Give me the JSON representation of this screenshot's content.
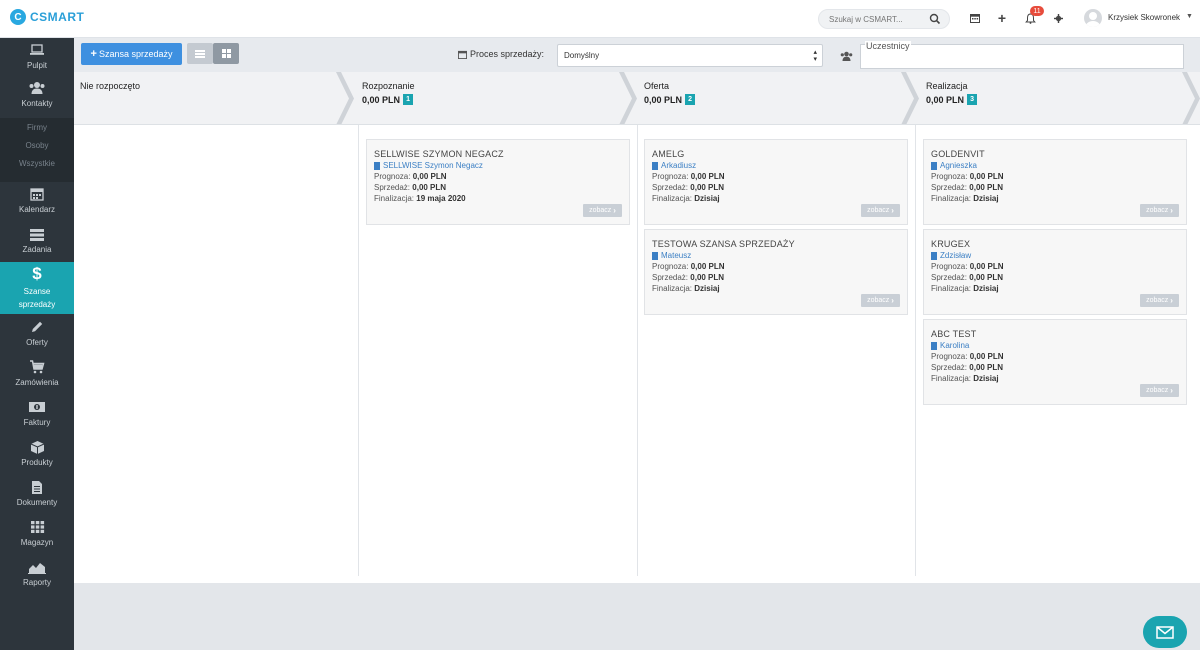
{
  "app": {
    "logo_text": "CSMART"
  },
  "header": {
    "search_placeholder": "Szukaj w CSMART...",
    "notification_count": "11",
    "user_name": "Krzysiek Skowronek"
  },
  "sidebar": {
    "items": [
      {
        "label": "Pulpit",
        "icon": "laptop-icon"
      },
      {
        "label": "Kontakty",
        "icon": "contacts-icon"
      },
      {
        "label": "Kalendarz",
        "icon": "calendar-icon"
      },
      {
        "label": "Zadania",
        "icon": "tasks-icon"
      },
      {
        "label": "Szanse sprzedaży",
        "icon": "dollar-icon"
      },
      {
        "label": "Oferty",
        "icon": "pencil-icon"
      },
      {
        "label": "Zamówienia",
        "icon": "cart-icon"
      },
      {
        "label": "Faktury",
        "icon": "money-icon"
      },
      {
        "label": "Produkty",
        "icon": "box-icon"
      },
      {
        "label": "Dokumenty",
        "icon": "document-icon"
      },
      {
        "label": "Magazyn",
        "icon": "grid-icon"
      },
      {
        "label": "Raporty",
        "icon": "chart-icon"
      }
    ],
    "subitems": [
      "Firmy",
      "Osoby",
      "Wszystkie"
    ]
  },
  "toolbar": {
    "add_button": "Szansa sprzedaży",
    "process_label": "Proces sprzedaży:",
    "process_value": "Domyślny",
    "participants_label": "Uczestnicy"
  },
  "stages": [
    {
      "name": "Nie rozpoczęto",
      "amount": "",
      "count": ""
    },
    {
      "name": "Rozpoznanie",
      "amount": "0,00 PLN",
      "count": "1"
    },
    {
      "name": "Oferta",
      "amount": "0,00 PLN",
      "count": "2"
    },
    {
      "name": "Realizacja",
      "amount": "0,00 PLN",
      "count": "3"
    }
  ],
  "labels": {
    "forecast": "Prognoza:",
    "sale": "Sprzedaż:",
    "finalization": "Finalizacja:",
    "view_button": "zobacz"
  },
  "cards": [
    {
      "title": "SELLWISE SZYMON NEGACZ",
      "contact": "SELLWISE Szymon Negacz",
      "forecast": "0,00 PLN",
      "sale": "0,00 PLN",
      "finalization": "19 maja 2020"
    },
    {
      "title": "AMELG",
      "contact": "Arkadiusz",
      "forecast": "0,00 PLN",
      "sale": "0,00 PLN",
      "finalization": "Dzisiaj"
    },
    {
      "title": "TESTOWA SZANSA SPRZEDAŻY",
      "contact": "Mateusz",
      "forecast": "0,00 PLN",
      "sale": "0,00 PLN",
      "finalization": "Dzisiaj"
    },
    {
      "title": "GOLDENVIT",
      "contact": "Agnieszka",
      "forecast": "0,00 PLN",
      "sale": "0,00 PLN",
      "finalization": "Dzisiaj"
    },
    {
      "title": "KRUGEX",
      "contact": "Zdzisław",
      "forecast": "0,00 PLN",
      "sale": "0,00 PLN",
      "finalization": "Dzisiaj"
    },
    {
      "title": "ABC TEST",
      "contact": "Karolina",
      "forecast": "0,00 PLN",
      "sale": "0,00 PLN",
      "finalization": "Dzisiaj"
    }
  ],
  "colors": {
    "accent": "#1aa4b0",
    "primary_button": "#3e90e0",
    "sidebar": "#2d353c",
    "link": "#3b7fc4",
    "badge": "#e74c3c"
  }
}
